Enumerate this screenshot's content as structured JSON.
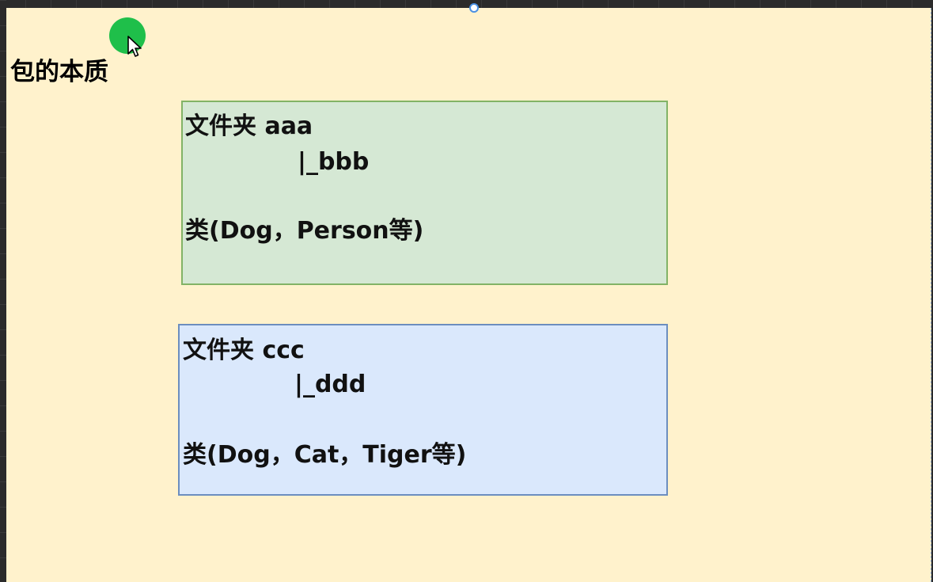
{
  "diagram": {
    "title": "包的本质",
    "packages": [
      {
        "folder_line": "文件夹 aaa",
        "subfolder_line": "|_bbb",
        "class_line": "类(Dog，Person等)",
        "fill_color": "#d5e8d4",
        "border_color": "#82b366"
      },
      {
        "folder_line": "文件夹 ccc",
        "subfolder_line": "|_ddd",
        "class_line": "类(Dog，Cat，Tiger等)",
        "fill_color": "#dae8fc",
        "border_color": "#6c8ebf"
      }
    ]
  },
  "canvas": {
    "background_color": "#fff2cc"
  },
  "pointer": {
    "highlight_color": "#1fbf4a",
    "icon": "cursor-arrow-icon"
  }
}
